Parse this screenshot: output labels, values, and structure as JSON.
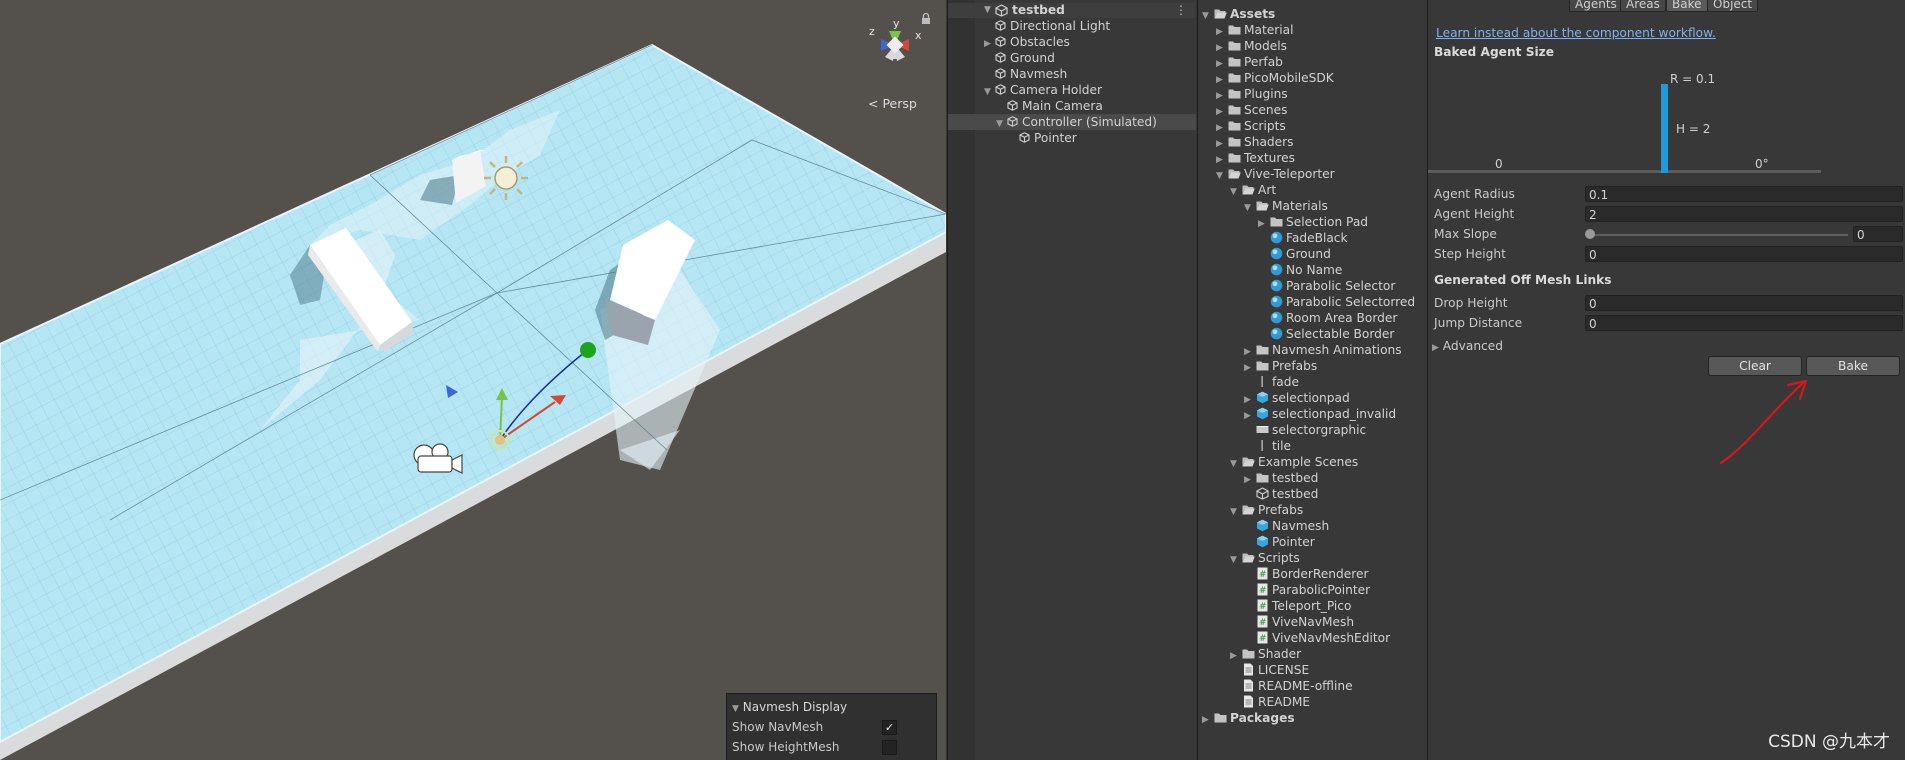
{
  "scene": {
    "persp_label": "Persp",
    "gizmo_axes": {
      "y": "y",
      "z": "z",
      "x": "x"
    },
    "navmesh_display": {
      "title": "Navmesh Display",
      "rows": [
        {
          "label": "Show NavMesh",
          "checked": true
        },
        {
          "label": "Show HeightMesh",
          "checked": false
        }
      ]
    }
  },
  "hierarchy": {
    "root": "testbed",
    "items": [
      {
        "label": "Directional Light",
        "depth": 1,
        "arrow": "",
        "icon": "gameobject-icon"
      },
      {
        "label": "Obstacles",
        "depth": 1,
        "arrow": "right",
        "icon": "gameobject-icon"
      },
      {
        "label": "Ground",
        "depth": 1,
        "arrow": "",
        "icon": "gameobject-icon"
      },
      {
        "label": "Navmesh",
        "depth": 1,
        "arrow": "",
        "icon": "gameobject-icon"
      },
      {
        "label": "Camera Holder",
        "depth": 1,
        "arrow": "down",
        "icon": "gameobject-icon"
      },
      {
        "label": "Main Camera",
        "depth": 2,
        "arrow": "",
        "icon": "gameobject-icon"
      },
      {
        "label": "Controller (Simulated)",
        "depth": 2,
        "arrow": "down",
        "icon": "gameobject-icon",
        "selected": true
      },
      {
        "label": "Pointer",
        "depth": 3,
        "arrow": "",
        "icon": "gameobject-icon"
      }
    ]
  },
  "project": {
    "items": [
      {
        "label": "Assets",
        "depth": 0,
        "arrow": "down",
        "icon": "folder-open-icon",
        "bold": true
      },
      {
        "label": "Material",
        "depth": 1,
        "arrow": "right",
        "icon": "folder-icon"
      },
      {
        "label": "Models",
        "depth": 1,
        "arrow": "right",
        "icon": "folder-icon"
      },
      {
        "label": "Perfab",
        "depth": 1,
        "arrow": "right",
        "icon": "folder-icon"
      },
      {
        "label": "PicoMobileSDK",
        "depth": 1,
        "arrow": "right",
        "icon": "folder-icon"
      },
      {
        "label": "Plugins",
        "depth": 1,
        "arrow": "right",
        "icon": "folder-icon"
      },
      {
        "label": "Scenes",
        "depth": 1,
        "arrow": "right",
        "icon": "folder-icon"
      },
      {
        "label": "Scripts",
        "depth": 1,
        "arrow": "right",
        "icon": "folder-icon"
      },
      {
        "label": "Shaders",
        "depth": 1,
        "arrow": "right",
        "icon": "folder-icon"
      },
      {
        "label": "Textures",
        "depth": 1,
        "arrow": "right",
        "icon": "folder-icon"
      },
      {
        "label": "Vive-Teleporter",
        "depth": 1,
        "arrow": "down",
        "icon": "folder-open-icon"
      },
      {
        "label": "Art",
        "depth": 2,
        "arrow": "down",
        "icon": "folder-open-icon"
      },
      {
        "label": "Materials",
        "depth": 3,
        "arrow": "down",
        "icon": "folder-open-icon"
      },
      {
        "label": "Selection Pad",
        "depth": 4,
        "arrow": "right",
        "icon": "folder-icon"
      },
      {
        "label": "FadeBlack",
        "depth": 4,
        "arrow": "",
        "icon": "material-icon"
      },
      {
        "label": "Ground",
        "depth": 4,
        "arrow": "",
        "icon": "material-icon"
      },
      {
        "label": "No Name",
        "depth": 4,
        "arrow": "",
        "icon": "material-icon"
      },
      {
        "label": "Parabolic Selector",
        "depth": 4,
        "arrow": "",
        "icon": "material-icon"
      },
      {
        "label": "Parabolic Selectorred",
        "depth": 4,
        "arrow": "",
        "icon": "material-icon"
      },
      {
        "label": "Room Area Border",
        "depth": 4,
        "arrow": "",
        "icon": "material-icon"
      },
      {
        "label": "Selectable Border",
        "depth": 4,
        "arrow": "",
        "icon": "material-icon"
      },
      {
        "label": "Navmesh Animations",
        "depth": 3,
        "arrow": "right",
        "icon": "folder-icon"
      },
      {
        "label": "Prefabs",
        "depth": 3,
        "arrow": "right",
        "icon": "folder-icon"
      },
      {
        "label": "fade",
        "depth": 3,
        "arrow": "",
        "icon": "texture-icon"
      },
      {
        "label": "selectionpad",
        "depth": 3,
        "arrow": "right",
        "icon": "prefab-icon"
      },
      {
        "label": "selectionpad_invalid",
        "depth": 3,
        "arrow": "right",
        "icon": "prefab-icon"
      },
      {
        "label": "selectorgraphic",
        "depth": 3,
        "arrow": "",
        "icon": "texture-stripe-icon"
      },
      {
        "label": "tile",
        "depth": 3,
        "arrow": "",
        "icon": "texture-icon"
      },
      {
        "label": "Example Scenes",
        "depth": 2,
        "arrow": "down",
        "icon": "folder-open-icon"
      },
      {
        "label": "testbed",
        "depth": 3,
        "arrow": "right",
        "icon": "folder-icon"
      },
      {
        "label": "testbed",
        "depth": 3,
        "arrow": "",
        "icon": "scene-icon"
      },
      {
        "label": "Prefabs",
        "depth": 2,
        "arrow": "down",
        "icon": "folder-open-icon"
      },
      {
        "label": "Navmesh",
        "depth": 3,
        "arrow": "",
        "icon": "prefab-icon"
      },
      {
        "label": "Pointer",
        "depth": 3,
        "arrow": "",
        "icon": "prefab-icon"
      },
      {
        "label": "Scripts",
        "depth": 2,
        "arrow": "down",
        "icon": "folder-open-icon"
      },
      {
        "label": "BorderRenderer",
        "depth": 3,
        "arrow": "",
        "icon": "script-icon"
      },
      {
        "label": "ParabolicPointer",
        "depth": 3,
        "arrow": "",
        "icon": "script-icon"
      },
      {
        "label": "Teleport_Pico",
        "depth": 3,
        "arrow": "",
        "icon": "script-icon"
      },
      {
        "label": "ViveNavMesh",
        "depth": 3,
        "arrow": "",
        "icon": "script-icon"
      },
      {
        "label": "ViveNavMeshEditor",
        "depth": 3,
        "arrow": "",
        "icon": "script-icon"
      },
      {
        "label": "Shader",
        "depth": 2,
        "arrow": "right",
        "icon": "folder-icon"
      },
      {
        "label": "LICENSE",
        "depth": 2,
        "arrow": "",
        "icon": "text-file-icon"
      },
      {
        "label": "README-offline",
        "depth": 2,
        "arrow": "",
        "icon": "text-file-icon"
      },
      {
        "label": "README",
        "depth": 2,
        "arrow": "",
        "icon": "text-file-icon"
      },
      {
        "label": "Packages",
        "depth": 0,
        "arrow": "right",
        "icon": "folder-icon",
        "bold": true
      }
    ]
  },
  "navigation": {
    "tabs": [
      {
        "label": "Agents",
        "active": false
      },
      {
        "label": "Areas",
        "active": false
      },
      {
        "label": "Bake",
        "active": true
      },
      {
        "label": "Object",
        "active": false
      }
    ],
    "link_text": "Learn instead about the component workflow.",
    "baked_agent_size_title": "Baked Agent Size",
    "diagram": {
      "radius_label": "R = 0.1",
      "height_label": "H = 2",
      "left_zero": "0",
      "slope_label": "0°"
    },
    "fields": [
      {
        "label": "Agent Radius",
        "value": "0.1"
      },
      {
        "label": "Agent Height",
        "value": "2"
      },
      {
        "label": "Max Slope",
        "value": "0",
        "slider": true
      },
      {
        "label": "Step Height",
        "value": "0"
      }
    ],
    "offmesh_title": "Generated Off Mesh Links",
    "offmesh_fields": [
      {
        "label": "Drop Height",
        "value": "0"
      },
      {
        "label": "Jump Distance",
        "value": "0"
      }
    ],
    "advanced_label": "Advanced",
    "clear_label": "Clear",
    "bake_label": "Bake"
  },
  "watermark": "CSDN @九本才",
  "colors": {
    "navmesh": "#b3e4f3",
    "link": "#7fb0f0",
    "annotation": "#d2181c",
    "selection": "#4a4a4a"
  }
}
